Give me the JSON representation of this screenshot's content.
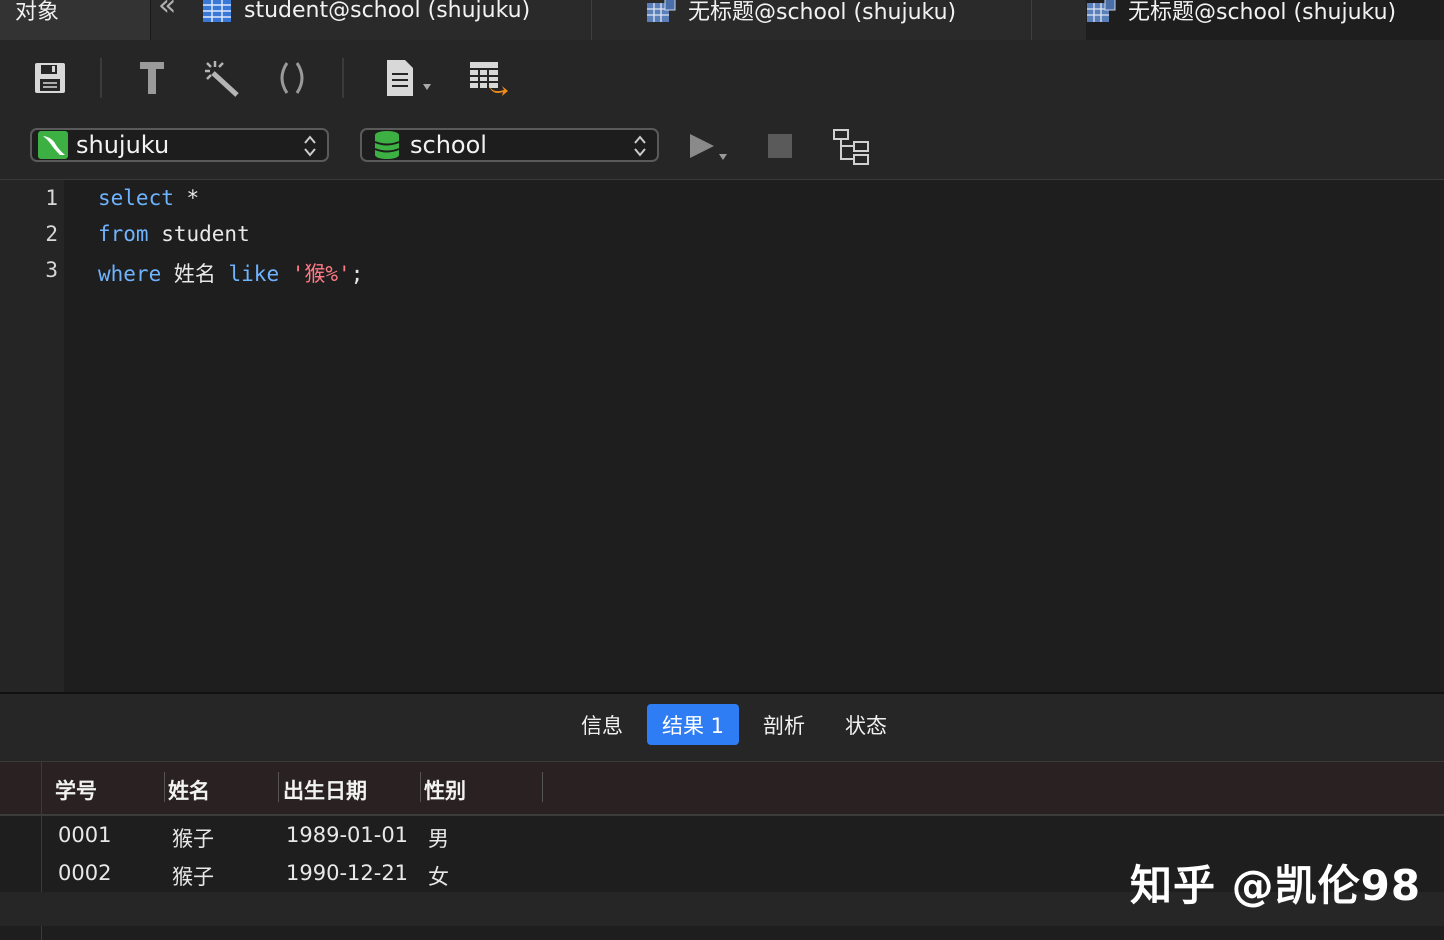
{
  "tabs": {
    "objects_label": "对象",
    "items": [
      {
        "label": "student@school (shujuku)"
      },
      {
        "label": "无标题@school (shujuku)"
      },
      {
        "label": "无标题@school (shujuku)"
      }
    ]
  },
  "selectors": {
    "connection": "shujuku",
    "database": "school"
  },
  "editor": {
    "line_numbers": [
      "1",
      "2",
      "3"
    ],
    "lines": [
      [
        {
          "t": "select",
          "c": "kw"
        },
        {
          "t": " *",
          "c": ""
        }
      ],
      [
        {
          "t": "from",
          "c": "kw"
        },
        {
          "t": " student",
          "c": ""
        }
      ],
      [
        {
          "t": "where",
          "c": "kw"
        },
        {
          "t": " 姓名 ",
          "c": ""
        },
        {
          "t": "like",
          "c": "kw"
        },
        {
          "t": " ",
          "c": ""
        },
        {
          "t": "'猴%'",
          "c": "str"
        },
        {
          "t": ";",
          "c": ""
        }
      ]
    ]
  },
  "result_tabs": [
    {
      "label": "信息",
      "active": false
    },
    {
      "label": "结果 1",
      "active": true
    },
    {
      "label": "剖析",
      "active": false
    },
    {
      "label": "状态",
      "active": false
    }
  ],
  "table": {
    "columns": [
      "学号",
      "姓名",
      "出生日期",
      "性别"
    ],
    "rows": [
      [
        "0001",
        "猴子",
        "1989-01-01",
        "男"
      ],
      [
        "0002",
        "猴子",
        "1990-12-21",
        "女"
      ]
    ]
  },
  "watermark": "知乎 @凯伦98",
  "colors": {
    "keyword": "#6fb3ff",
    "string": "#ff7a85",
    "active_tab": "#2f7df5"
  }
}
